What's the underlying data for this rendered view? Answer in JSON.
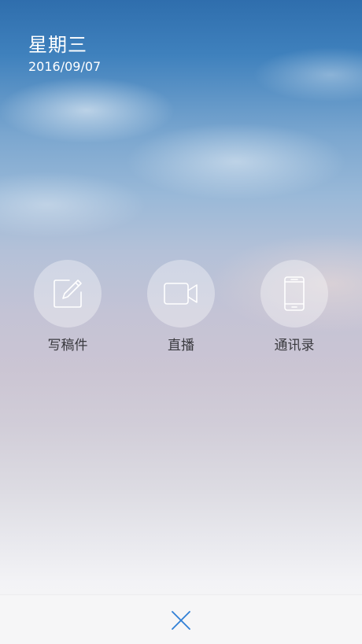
{
  "header": {
    "weekday": "星期三",
    "date": "2016/09/07"
  },
  "actions": [
    {
      "label": "写稿件",
      "icon": "edit-icon"
    },
    {
      "label": "直播",
      "icon": "video-camera-icon"
    },
    {
      "label": "通讯录",
      "icon": "phone-icon"
    }
  ],
  "bottom_bar": {
    "close_icon": "close-icon",
    "accent_color": "#2f7fd6"
  }
}
